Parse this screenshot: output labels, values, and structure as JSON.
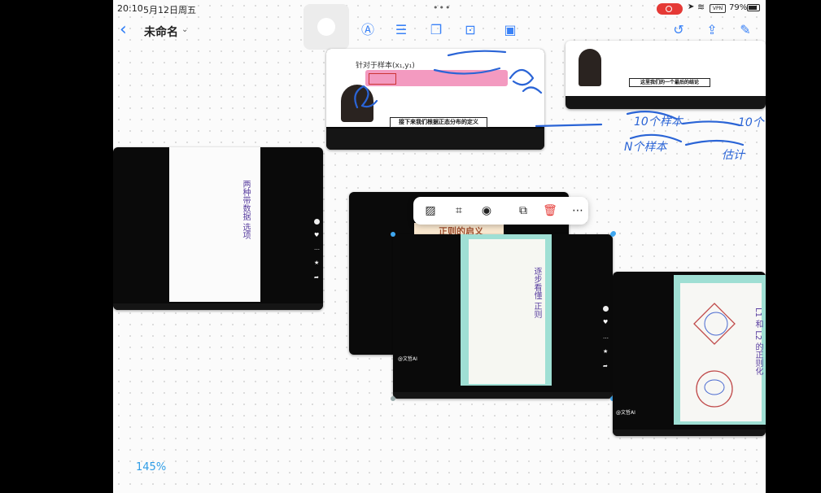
{
  "status": {
    "time": "20:10",
    "date": "5月12日周五",
    "battery": "79%"
  },
  "doc": {
    "title": "未命名"
  },
  "zoom": "145%",
  "colors": {
    "accent": "#3a82f7",
    "record": "#e53935",
    "ink": "#2a64d6",
    "handle": "#3fa7f0"
  },
  "toolbar": {
    "center_tools": [
      {
        "name": "pen-tool-icon",
        "glyph": "Ⓐ"
      },
      {
        "name": "note-tool-icon",
        "glyph": "☰"
      },
      {
        "name": "shape-tool-icon",
        "glyph": "❐"
      },
      {
        "name": "textbox-tool-icon",
        "glyph": "⊡"
      },
      {
        "name": "media-tool-icon",
        "glyph": "▣"
      }
    ],
    "right_tools": [
      {
        "name": "undo-icon",
        "glyph": "↺"
      },
      {
        "name": "share-icon",
        "glyph": "⇪"
      },
      {
        "name": "edit-icon",
        "glyph": "✎"
      }
    ]
  },
  "context_menu": [
    {
      "name": "image-icon",
      "glyph": "▨"
    },
    {
      "name": "crop-icon",
      "glyph": "⌗"
    },
    {
      "name": "preview-eye-icon",
      "glyph": "◉"
    },
    {
      "name": "duplicate-icon",
      "glyph": "⧉"
    },
    {
      "name": "delete-trash-icon",
      "glyph": "🗑"
    },
    {
      "name": "more-icon",
      "glyph": "⋯"
    }
  ],
  "cards": {
    "top_video": {
      "caption": "接下来我们根据正态分布的定义",
      "formula_label": "针对于样本(x₁,y₁)"
    },
    "top_right_video": {
      "caption": "这里我们的一个最后的结论"
    },
    "left_video": {
      "heading": "两种带数据 选项"
    },
    "mid_back": {
      "label": "正则的启义"
    },
    "mid_front": {
      "heading": "逐步看懂 正则",
      "author": "@文哲AI"
    },
    "right_video": {
      "heading": "L1 和 L2 的正则化",
      "author": "@文哲AI"
    }
  },
  "ink_notes": {
    "a": "10个样本",
    "b": "N个样本",
    "c": "10个",
    "d": "估计"
  }
}
